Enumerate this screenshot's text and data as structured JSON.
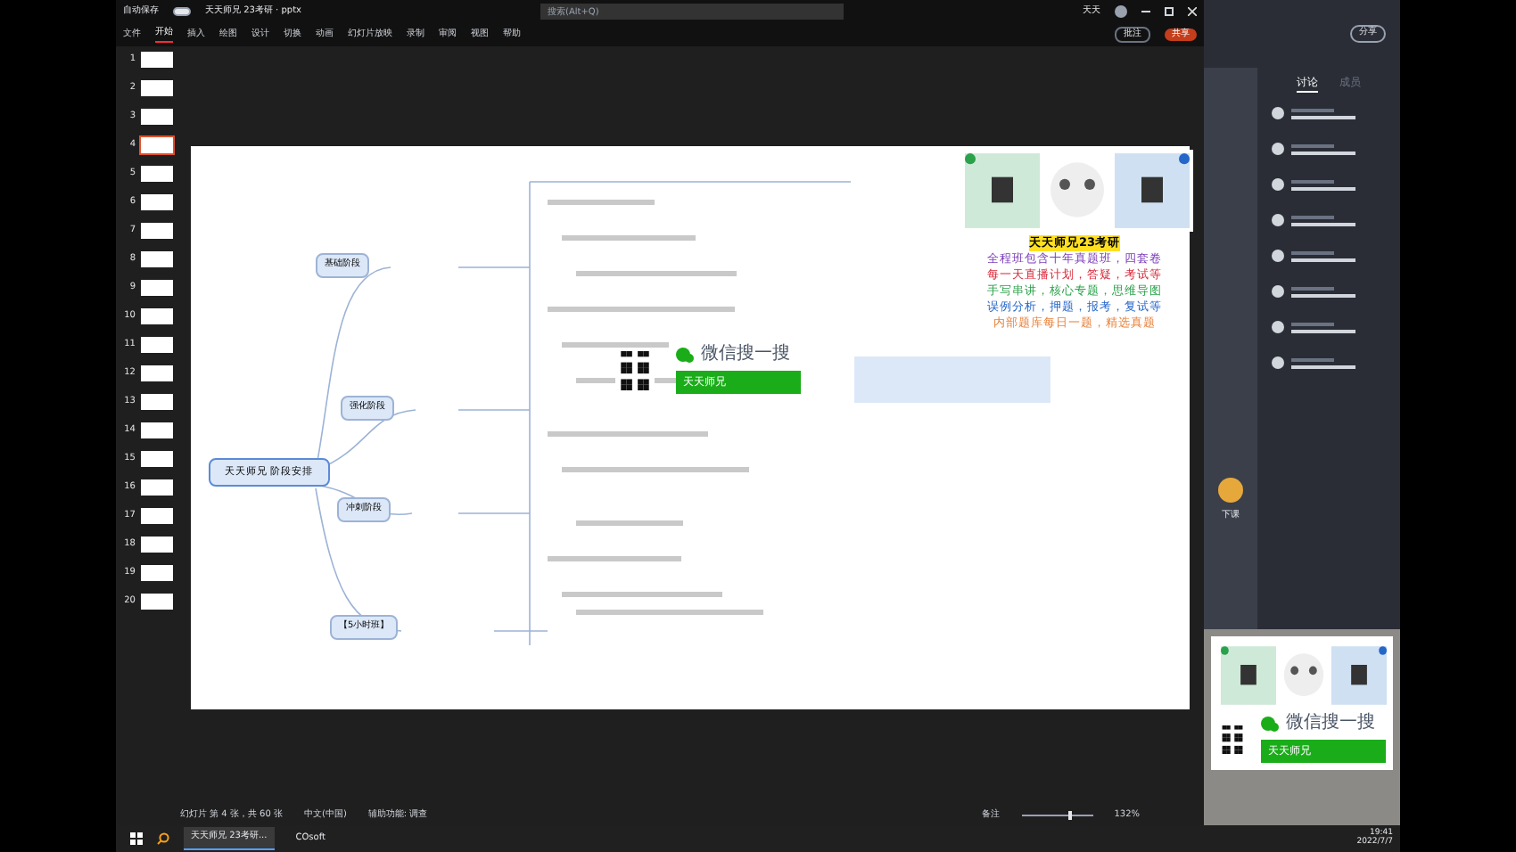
{
  "window": {
    "app_title": "天天师兄 23考研 · pptx",
    "search": {
      "placeholder": "搜索(Alt+Q)"
    },
    "user": "天天",
    "share": "共享",
    "comment": "批注",
    "autosave": "自动保存",
    "autosave_on": true
  },
  "ribbon_tabs": [
    {
      "label": "文件",
      "selected": false
    },
    {
      "label": "开始",
      "selected": true
    },
    {
      "label": "插入",
      "selected": false
    },
    {
      "label": "绘图",
      "selected": false
    },
    {
      "label": "设计",
      "selected": false
    },
    {
      "label": "切换",
      "selected": false
    },
    {
      "label": "动画",
      "selected": false
    },
    {
      "label": "幻灯片放映",
      "selected": false
    },
    {
      "label": "录制",
      "selected": false
    },
    {
      "label": "审阅",
      "selected": false
    },
    {
      "label": "视图",
      "selected": false
    },
    {
      "label": "帮助",
      "selected": false
    }
  ],
  "thumbnails": [
    {
      "number": "1",
      "selected": false
    },
    {
      "number": "2",
      "selected": false
    },
    {
      "number": "3",
      "selected": false
    },
    {
      "number": "4",
      "selected": true
    },
    {
      "number": "5",
      "selected": false
    },
    {
      "number": "6",
      "selected": false
    },
    {
      "number": "7",
      "selected": false
    },
    {
      "number": "8",
      "selected": false
    },
    {
      "number": "9",
      "selected": false
    },
    {
      "number": "10",
      "selected": false
    },
    {
      "number": "11",
      "selected": false
    },
    {
      "number": "12",
      "selected": false
    },
    {
      "number": "13",
      "selected": false
    },
    {
      "number": "14",
      "selected": false
    },
    {
      "number": "15",
      "selected": false
    },
    {
      "number": "16",
      "selected": false
    },
    {
      "number": "17",
      "selected": false
    },
    {
      "number": "18",
      "selected": false
    },
    {
      "number": "19",
      "selected": false
    },
    {
      "number": "20",
      "selected": false
    }
  ],
  "slide": {
    "root": "天天师兄 阶段安排",
    "stages": [
      {
        "label": "基础阶段"
      },
      {
        "label": "强化阶段"
      },
      {
        "label": "冲刺阶段"
      },
      {
        "label": "【5小时班】"
      }
    ],
    "promo_title": "天天师兄23考研",
    "promo_lines": [
      {
        "text": "全程班包含十年真题班，四套卷",
        "color": "#7b3fb8"
      },
      {
        "text": "每一天直播计划，答疑，考试等",
        "color": "#d8283a"
      },
      {
        "text": "手写串讲，核心专题，思维导图",
        "color": "#2aa14a"
      },
      {
        "text": "误例分析，押题，报考，复试等",
        "color": "#2566c9"
      },
      {
        "text": "内部题库每日一题，精选真题",
        "color": "#e8813a"
      }
    ],
    "wechat_search": "微信搜一搜",
    "wechat_account": "天天师兄"
  },
  "status_bar": {
    "slide": "幻灯片 第 4 张，共 60 张",
    "language": "中文(中国)",
    "accessibility": "辅助功能: 调查",
    "notes": "备注",
    "zoom": "132%",
    "zoom_slider": {
      "level": 0.7
    }
  },
  "taskbar": {
    "apps": [
      {
        "label": "天天师兄 23考研...",
        "selected": true
      },
      {
        "label": "COsoft",
        "selected": false
      }
    ],
    "time": "19:41",
    "date": "2022/7/7"
  },
  "chat": {
    "tabs": [
      {
        "label": "讨论",
        "selected": true
      },
      {
        "label": "成员",
        "selected": false
      }
    ],
    "buttons": [
      "分享"
    ],
    "presenter": "下课",
    "wechat_search": "微信搜一搜",
    "wechat_account": "天天师兄"
  }
}
